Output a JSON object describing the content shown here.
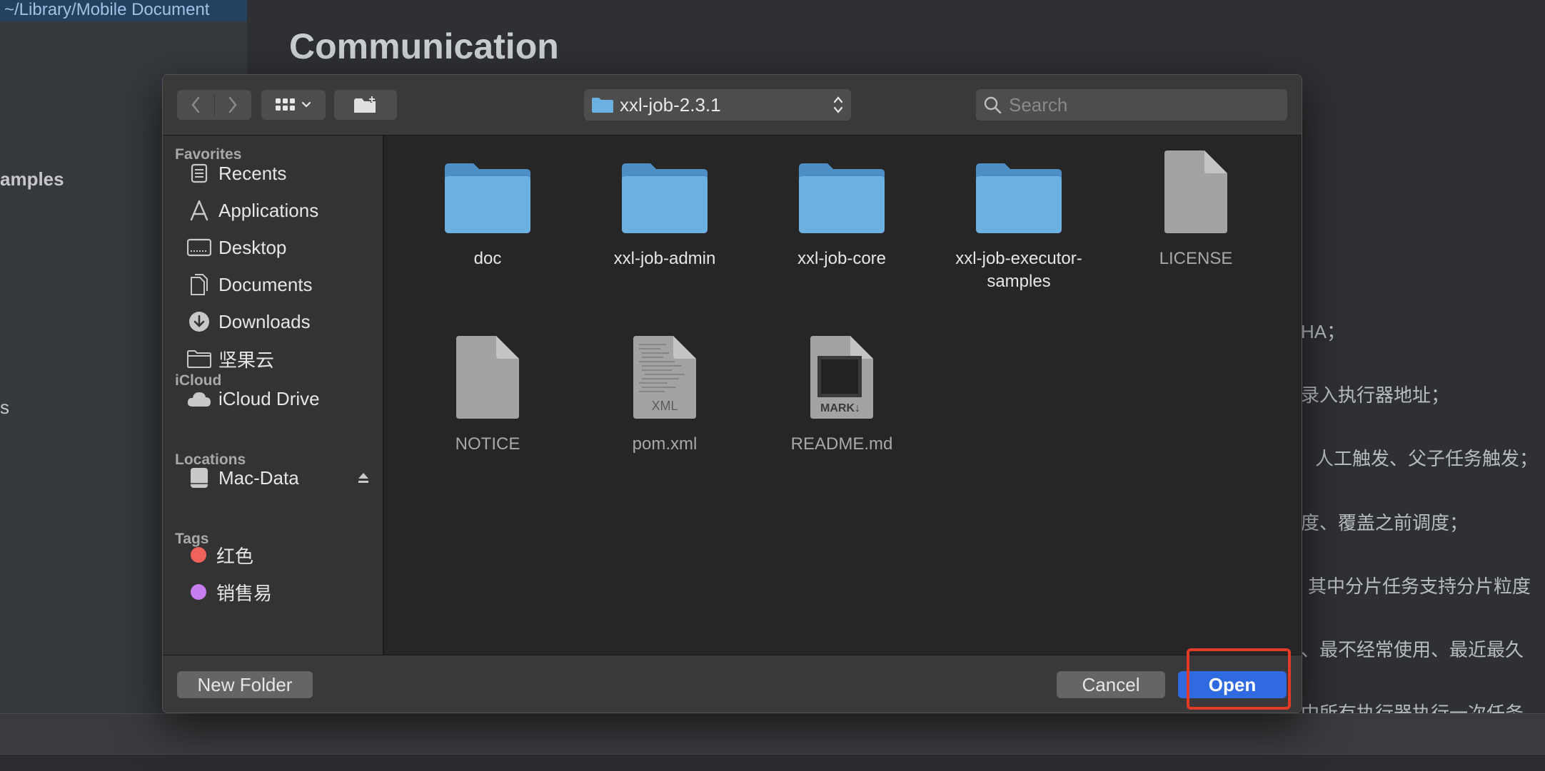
{
  "background": {
    "path_text": "~/Library/Mobile Document",
    "sidebar_fragments": [
      "amples",
      "s"
    ],
    "heading": "Communication",
    "content_lines": [
      "HA；",
      "录入执行器地址；",
      "人工触发、父子任务触发；",
      "度、覆盖之前调度；",
      "其中分片任务支持分片粒度",
      "、最不经常使用、最近最久",
      "中所有执行器执行一次任务"
    ]
  },
  "toolbar": {
    "current_folder": "xxl-job-2.3.1",
    "search_placeholder": "Search",
    "back_icon": "chevron-left-icon",
    "forward_icon": "chevron-right-icon",
    "view_icon": "icon-grid-icon",
    "new_folder_icon": "new-folder-icon"
  },
  "sidebar": {
    "favorites_header": "Favorites",
    "favorites": [
      {
        "label": "Recents",
        "icon": "recents-icon"
      },
      {
        "label": "Applications",
        "icon": "applications-icon"
      },
      {
        "label": "Desktop",
        "icon": "desktop-icon"
      },
      {
        "label": "Documents",
        "icon": "documents-icon"
      },
      {
        "label": "Downloads",
        "icon": "downloads-icon"
      },
      {
        "label": "坚果云",
        "icon": "folder-icon"
      }
    ],
    "icloud_header": "iCloud",
    "icloud": [
      {
        "label": "iCloud Drive",
        "icon": "cloud-icon"
      }
    ],
    "locations_header": "Locations",
    "locations": [
      {
        "label": "Mac-Data",
        "icon": "disk-icon"
      }
    ],
    "tags_header": "Tags",
    "tags": [
      {
        "label": "红色",
        "color": "#f0625c"
      },
      {
        "label": "销售易",
        "color": "#c77cf0"
      }
    ]
  },
  "files": [
    {
      "name": "doc",
      "type": "folder"
    },
    {
      "name": "xxl-job-admin",
      "type": "folder"
    },
    {
      "name": "xxl-job-core",
      "type": "folder"
    },
    {
      "name": "xxl-job-executor-samples",
      "type": "folder"
    },
    {
      "name": "LICENSE",
      "type": "document"
    },
    {
      "name": "NOTICE",
      "type": "document"
    },
    {
      "name": "pom.xml",
      "type": "xml",
      "badge": "XML"
    },
    {
      "name": "README.md",
      "type": "markdown",
      "badge": "MARK↓"
    }
  ],
  "buttons": {
    "new_folder": "New Folder",
    "cancel": "Cancel",
    "open": "Open"
  },
  "colors": {
    "accent": "#2f6ae0",
    "highlight": "#e33a27",
    "folder": "#6cb0e0"
  }
}
